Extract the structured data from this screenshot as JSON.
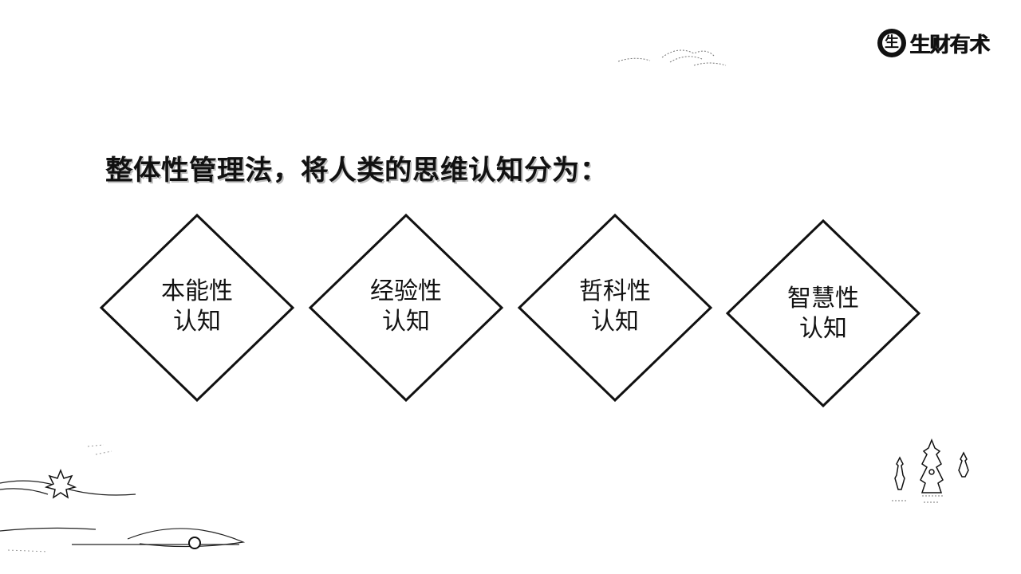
{
  "logo": {
    "mark": "生",
    "text": "生财有术"
  },
  "headline": "整体性管理法，将人类的思维认知分为：",
  "diamonds": [
    {
      "line1": "本能性",
      "line2": "认知"
    },
    {
      "line1": "经验性",
      "line2": "认知"
    },
    {
      "line1": "哲科性",
      "line2": "认知"
    },
    {
      "line1": "智慧性",
      "line2": "认知"
    }
  ],
  "colors": {
    "ink": "#111111",
    "background": "#ffffff",
    "shadow": "#bdbdbd"
  },
  "icons": [
    "logo-circle-icon",
    "cloud-icon",
    "maple-leaf-icon",
    "pagoda-icon",
    "boat-icon"
  ]
}
